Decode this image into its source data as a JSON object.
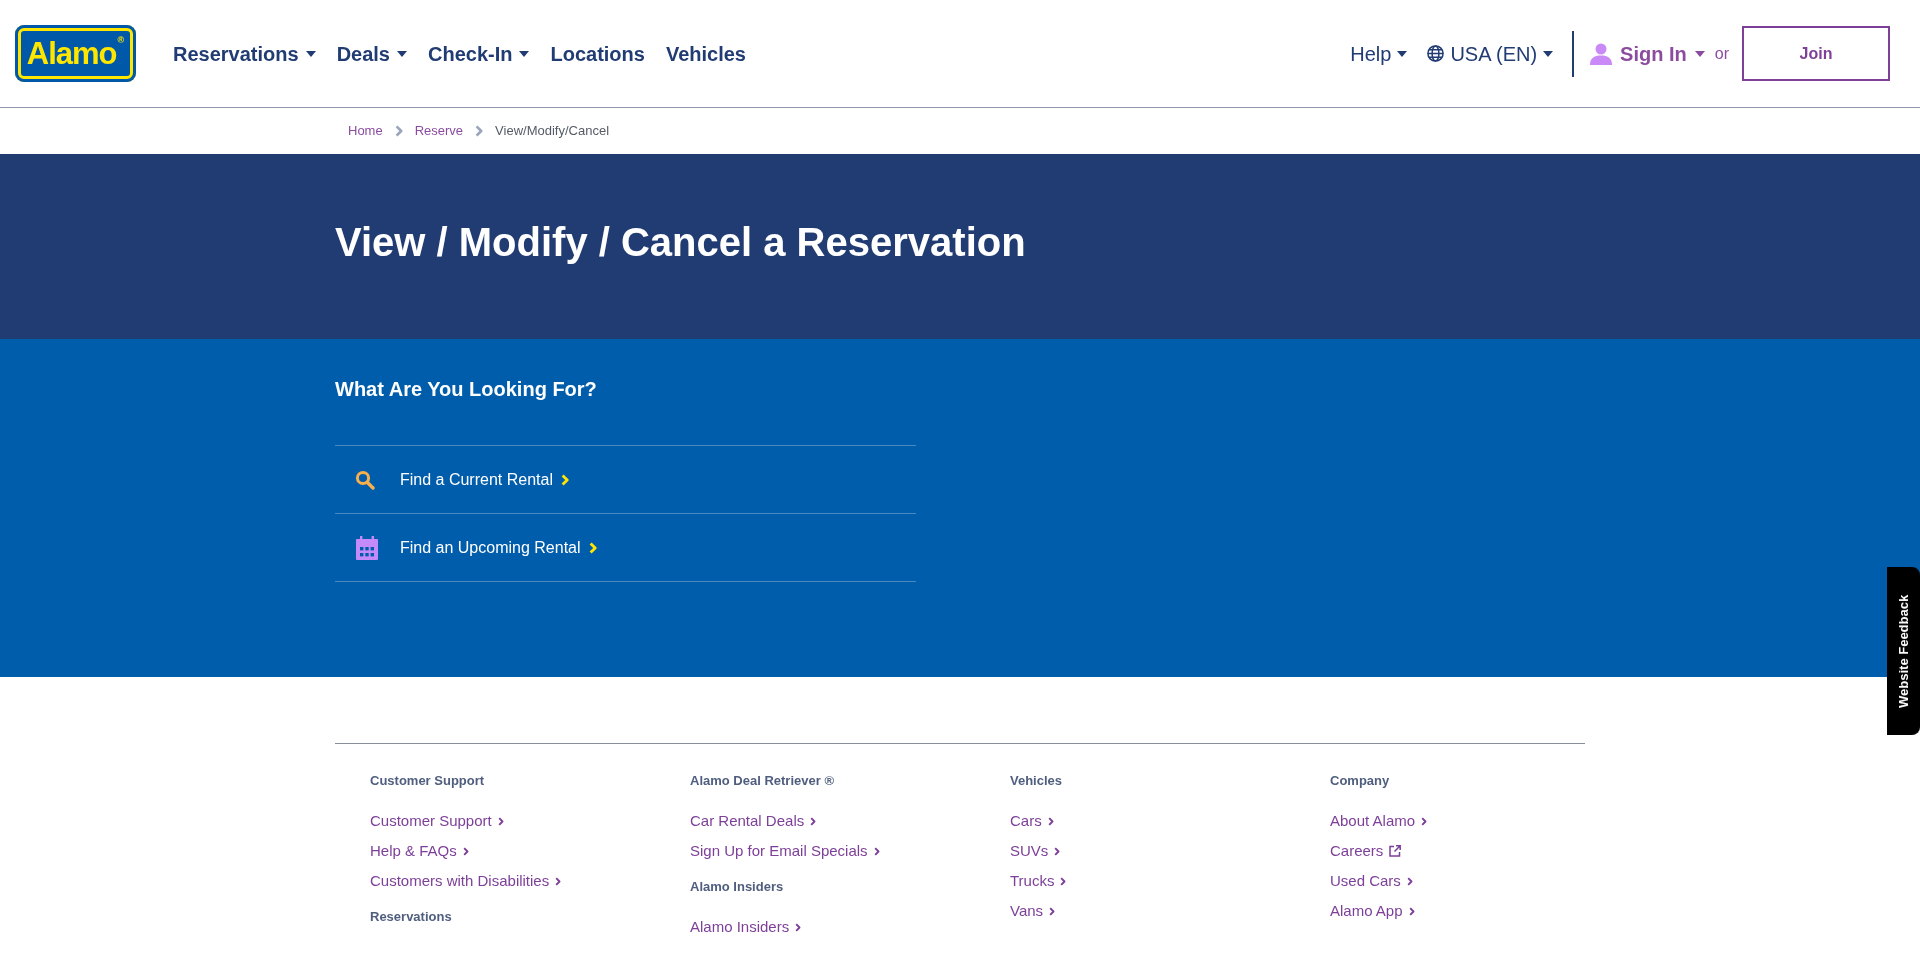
{
  "header": {
    "logo": "Alamo$^{®}$",
    "nav": [
      {
        "label": "Reservations",
        "dropdown": true
      },
      {
        "label": "Deals",
        "dropdown": true
      },
      {
        "label": "Check-In",
        "dropdown": true
      },
      {
        "label": "Locations",
        "dropdown": false
      },
      {
        "label": "Vehicles",
        "dropdown": false
      }
    ],
    "utility": [
      {
        "label": "Help",
        "kind": "menu"
      },
      {
        "label": "USA (EN)",
        "kind": "locale"
      }
    ],
    "account": {
      "sign_in": {
        "label": "Sign In",
        "dropdown": true
      },
      "or": "or",
      "join": "Join"
    }
  },
  "breadcrumb": [
    {
      "label": "Home",
      "current": false
    },
    {
      "label": "Reserve",
      "current": false
    },
    {
      "label": "View/Modify/Cancel",
      "current": true
    }
  ],
  "banner": {
    "title": "View / Modify / Cancel a Reservation"
  },
  "finder": {
    "heading": "What Are You Looking For?",
    "options": [
      {
        "label": "Find a Current Rental",
        "kind": "search"
      },
      {
        "label": "Find an Upcoming Rental",
        "kind": "calendar"
      }
    ]
  },
  "footer": {
    "columns": [
      {
        "sections": [
          {
            "heading": "Customer Support",
            "links": [
              {
                "label": "Customer Support",
                "external": false
              },
              {
                "label": "Help & FAQs",
                "external": false
              },
              {
                "label": "Customers with Disabilities",
                "external": false
              }
            ]
          },
          {
            "heading": "Reservations"
          }
        ]
      },
      {
        "sections": [
          {
            "heading": "Alamo Deal Retriever ®",
            "links": [
              {
                "label": "Car Rental Deals",
                "external": false
              },
              {
                "label": "Sign Up for Email Specials",
                "external": false
              }
            ]
          },
          {
            "heading": "Alamo Insiders",
            "links": [
              {
                "label": "Alamo Insiders",
                "external": false
              }
            ]
          }
        ]
      },
      {
        "sections": [
          {
            "heading": "Vehicles",
            "links": [
              {
                "label": "Cars",
                "external": false
              },
              {
                "label": "SUVs",
                "external": false
              },
              {
                "label": "Trucks",
                "external": false
              },
              {
                "label": "Vans",
                "external": false
              }
            ]
          }
        ]
      },
      {
        "sections": [
          {
            "heading": "Company",
            "links": [
              {
                "label": "About Alamo",
                "external": false
              },
              {
                "label": "Careers",
                "external": true
              },
              {
                "label": "Used Cars",
                "external": false
              },
              {
                "label": "Alamo App",
                "external": false
              }
            ]
          }
        ]
      }
    ]
  },
  "feedback": {
    "label": "Website Feedback"
  }
}
